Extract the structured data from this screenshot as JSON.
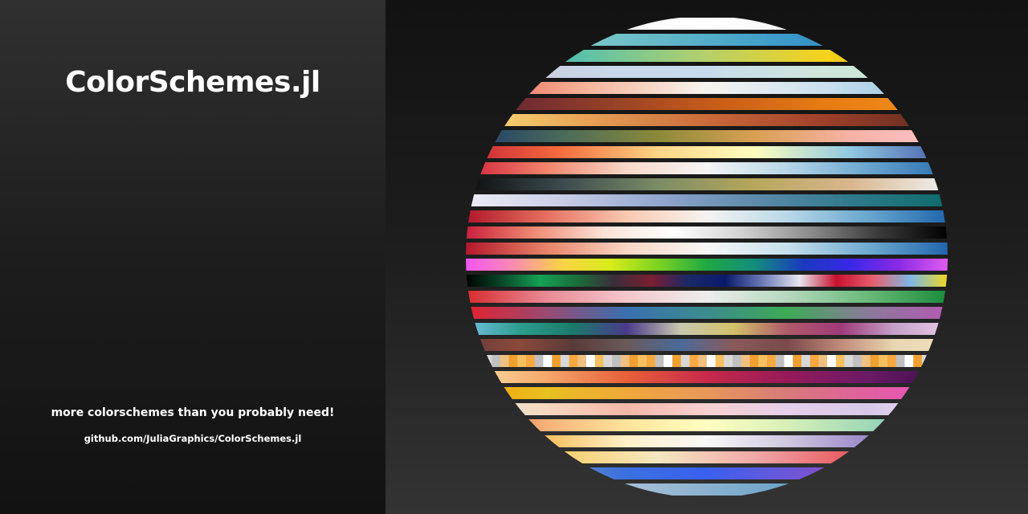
{
  "title": "ColorSchemes.jl",
  "tagline": "more colorschemes than you probably need!",
  "url": "github.com/JuliaGraphics/ColorSchemes.jl",
  "background": {
    "left_top": "#303030",
    "left_bottom": "#121212",
    "right_top": "#121212",
    "right_bottom": "#333333"
  },
  "colorschemes": [
    {
      "stops": [
        "#f5f5f5",
        "#ffffff",
        "#eaeaea"
      ]
    },
    {
      "stops": [
        "#a6dcc6",
        "#6ec0c8",
        "#3a9ac9",
        "#2a6fb2"
      ]
    },
    {
      "stops": [
        "#0aa4d8",
        "#5ec2a8",
        "#b6d06a",
        "#f6d21a",
        "#c79a20"
      ]
    },
    {
      "stops": [
        "#d9bcd4",
        "#c8d6e8",
        "#c6dcec",
        "#cfe6da",
        "#bfe3d3"
      ]
    },
    {
      "stops": [
        "#e65b4b",
        "#f6b49a",
        "#f7f4f0",
        "#c9dfee",
        "#86c0dc"
      ]
    },
    {
      "stops": [
        "#5a1f3a",
        "#8a3a2a",
        "#c45a1a",
        "#e67d14",
        "#f49019"
      ]
    },
    {
      "stops": [
        "#fbe27a",
        "#e8a256",
        "#c96a3b",
        "#9d3f29",
        "#5a2a22"
      ]
    },
    {
      "stops": [
        "#1b3a6b",
        "#4a6a5a",
        "#8c8a3a",
        "#d9a053",
        "#f7b2a6",
        "#ffc3c9"
      ]
    },
    {
      "stops": [
        "#c8233a",
        "#f46e3d",
        "#fdd587",
        "#fefebf",
        "#8fc7e1",
        "#445ca8"
      ]
    },
    {
      "stops": [
        "#d3223a",
        "#f1846b",
        "#f8d8c8",
        "#f5f5f5",
        "#b7d6e7",
        "#6aa6cf",
        "#2a6fb0"
      ]
    },
    {
      "stops": [
        "#0d0d0d",
        "#3c4a4e",
        "#7c8c66",
        "#b7a75b",
        "#d9b690",
        "#f0f0f0"
      ]
    },
    {
      "stops": [
        "#eeeef6",
        "#c9cde6",
        "#93a6cf",
        "#5d8aab",
        "#2f7a8a",
        "#0e6b6b"
      ]
    },
    {
      "stops": [
        "#b0182c",
        "#e56f5e",
        "#f9c9b1",
        "#f5f3f1",
        "#b9d8e8",
        "#69a7cf",
        "#2166ac"
      ]
    },
    {
      "stops": [
        "#c8203c",
        "#ef8b74",
        "#fbe2d7",
        "#ffffff",
        "#d3d3d3",
        "#8c8c8c",
        "#3a3a3a",
        "#000000"
      ]
    },
    {
      "stops": [
        "#b2182b",
        "#e78367",
        "#fad6c4",
        "#f7f7f7",
        "#c6dfed",
        "#6fabd0",
        "#2166ac"
      ]
    },
    {
      "stops": [
        "#f055f0",
        "#f98cb0",
        "#fbd345",
        "#d7ec1a",
        "#7bd220",
        "#1fa844",
        "#128c7c",
        "#1a3ac0",
        "#3a28e8",
        "#8c2ae6",
        "#e05cf0"
      ]
    },
    {
      "stops": [
        "#000000",
        "#0a4a2a",
        "#15a055",
        "#1a6e3a",
        "#3a2e3a",
        "#7a1e32",
        "#1a2868",
        "#0a1a6a",
        "#6a7ab8",
        "#e6e6f0",
        "#c8102e",
        "#e66070",
        "#7eb8e6",
        "#f0d820"
      ]
    },
    {
      "stops": [
        "#d62b2e",
        "#e98a95",
        "#f3c7cc",
        "#ededed",
        "#b6d8be",
        "#6aba7a",
        "#1a8a3a"
      ]
    },
    {
      "stops": [
        "#e3212e",
        "#9a4a72",
        "#3a70b0",
        "#3c8c8e",
        "#3daa55",
        "#8a7a9a",
        "#b35ab0"
      ]
    },
    {
      "stops": [
        "#73bfe0",
        "#2d9e8e",
        "#1a7a6a",
        "#4a3a8a",
        "#c8c8b0",
        "#d3c26a",
        "#b05a6a",
        "#a03a7a",
        "#c4a0c8",
        "#e8c8e8"
      ]
    },
    {
      "stops": [
        "#6a3a3a",
        "#8a4a3a",
        "#5a3a3a",
        "#6a5a5a",
        "#4a6a9a",
        "#8a5a5a",
        "#7a4a4a",
        "#c08a7a",
        "#e8d6b0",
        "#f0e0c0"
      ]
    },
    {
      "stops": [
        "#ffffff",
        "#888888",
        "#f0a030",
        "#7a3a0a",
        "#f6c060",
        "#c08020",
        "#d8d8d8",
        "#8a5a2a",
        "#f8a840",
        "#1a3a6a",
        "#c0c0c0",
        "#5a3a2a",
        "#f0c080",
        "#e8e8e8"
      ],
      "segmented": true
    },
    {
      "stops": [
        "#fde2a8",
        "#f4a86a",
        "#e8603a",
        "#c8294a",
        "#961a5a",
        "#6a1a66",
        "#3a0f4a"
      ]
    },
    {
      "stops": [
        "#f5a00a",
        "#e8c020",
        "#f0a83a",
        "#e8985a",
        "#d87a7a",
        "#e060a0",
        "#f050c0"
      ]
    },
    {
      "stops": [
        "#dff0d8",
        "#f8d8c0",
        "#f4b8a8",
        "#f8d0d0",
        "#e4d0ea",
        "#d8c8e8",
        "#f0e0f8"
      ]
    },
    {
      "stops": [
        "#e8563a",
        "#f6b278",
        "#fde49a",
        "#fefec0",
        "#d8f0b8",
        "#a0d8b8",
        "#68bcb8"
      ]
    },
    {
      "stops": [
        "#e8782a",
        "#f8c060",
        "#fef0c8",
        "#f8f8f8",
        "#d0c8e0",
        "#9a88c8",
        "#6050a0"
      ]
    },
    {
      "stops": [
        "#f4a82a",
        "#f8d070",
        "#f4e8c0",
        "#f0a8a8",
        "#e85a60",
        "#c82840"
      ]
    },
    {
      "stops": [
        "#98c8a8",
        "#6a90c0",
        "#3a70e0",
        "#3a60f0",
        "#6a58d8",
        "#9a48c0",
        "#c04898"
      ]
    },
    {
      "stops": [
        "#e8eef8",
        "#a8c0d8",
        "#6ca4c8",
        "#3a88b0"
      ]
    },
    {
      "stops": [
        "#f0f0f0",
        "#d8d8d8",
        "#b0b0b0"
      ]
    }
  ]
}
